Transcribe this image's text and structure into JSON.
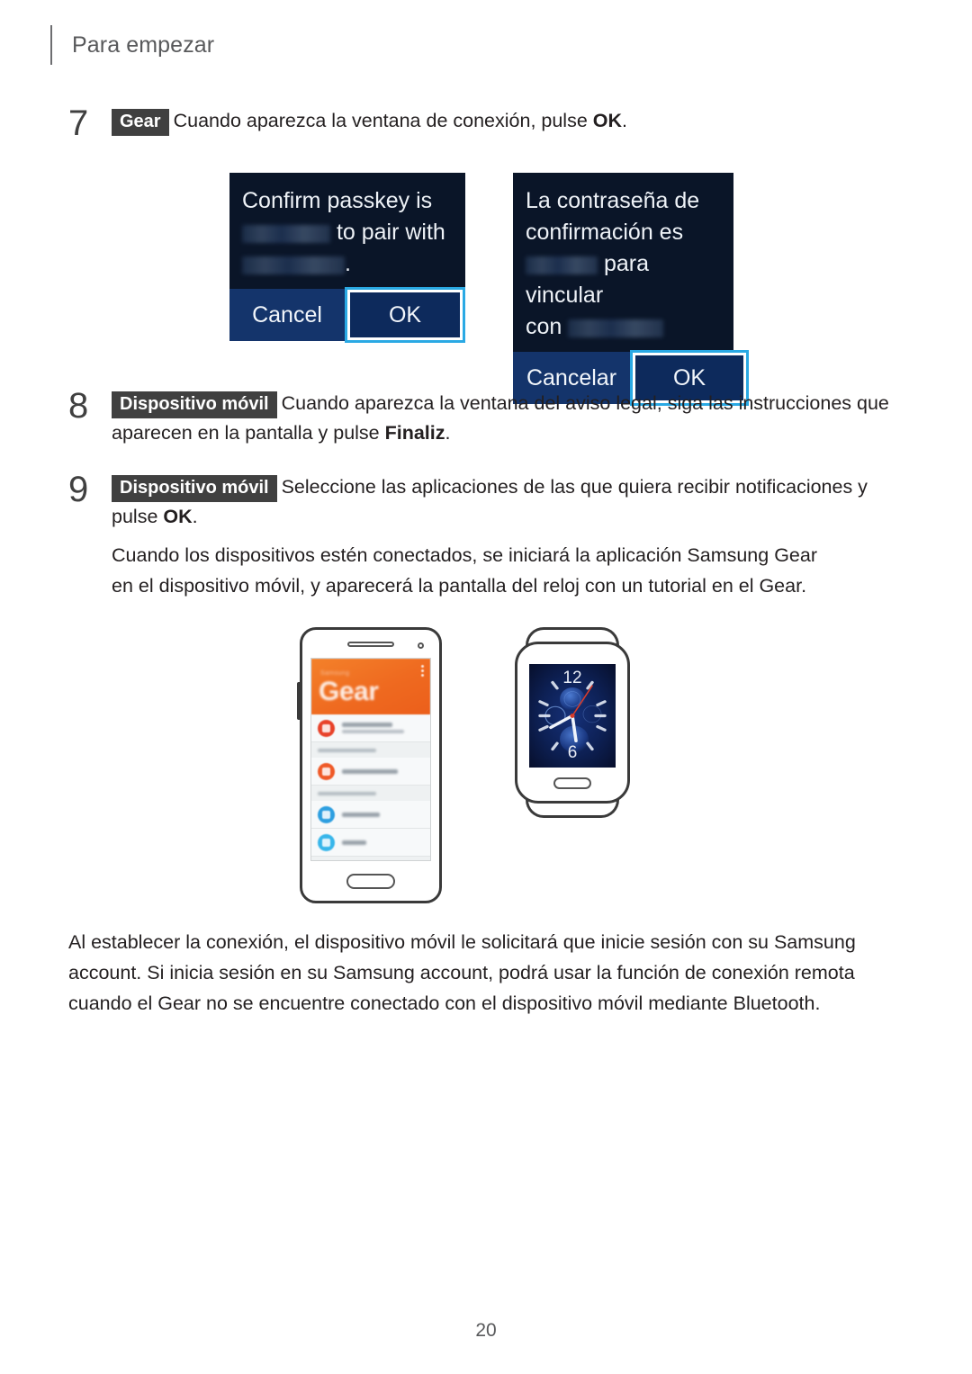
{
  "header": {
    "title": "Para empezar"
  },
  "steps": [
    {
      "number": "7",
      "badge": "Gear",
      "text_before": "Cuando aparezca la ventana de conexión, pulse ",
      "bold": "OK",
      "text_after": "."
    },
    {
      "number": "8",
      "badge": "Dispositivo móvil",
      "text_before": "Cuando aparezca la ventana del aviso legal, siga las instrucciones que aparecen en la pantalla y pulse ",
      "bold": "Finaliz",
      "text_after": "."
    },
    {
      "number": "9",
      "badge": "Dispositivo móvil",
      "text_before": "Seleccione las aplicaciones de las que quiera recibir notificaciones y pulse ",
      "bold": "OK",
      "text_after": "."
    }
  ],
  "paragraphs": {
    "after_step9": "Cuando los dispositivos estén conectados, se iniciará la aplicación Samsung Gear en el dispositivo móvil, y aparecerá la pantalla del reloj con un tutorial en el Gear.",
    "bottom": "Al establecer la conexión, el dispositivo móvil le solicitará que inicie sesión con su Samsung account. Si inicia sesión en su Samsung account, podrá usar la función de conexión remota cuando el Gear no se encuentre conectado con el dispositivo móvil mediante Bluetooth."
  },
  "dialogs": {
    "english": {
      "line1": "Confirm passkey is",
      "line2": "to pair with",
      "line3_suffix": ".",
      "cancel_label": "Cancel",
      "ok_label": "OK"
    },
    "spanish": {
      "line1": "La contraseña de",
      "line2": "confirmación es",
      "line3": "para vincular",
      "line4_prefix": "con",
      "cancel_label": "Cancelar",
      "ok_label": "OK"
    }
  },
  "illustrations": {
    "phone": {
      "app_brand_small": "Samsung",
      "app_brand_large": "Gear"
    },
    "watch": {
      "hour_top": "12",
      "hour_bottom": "6"
    }
  },
  "footer": {
    "page_number": "20"
  },
  "colors": {
    "badge_bg": "#404040",
    "dialog_body": "#0a1528",
    "dialog_footer": "#14346b",
    "ok_border": "#2aa9e4",
    "ok_fill": "#0d2a5c",
    "gear_orange": "#ef6a20",
    "watch_face": "#0b1b44",
    "header_text": "#58595b"
  }
}
